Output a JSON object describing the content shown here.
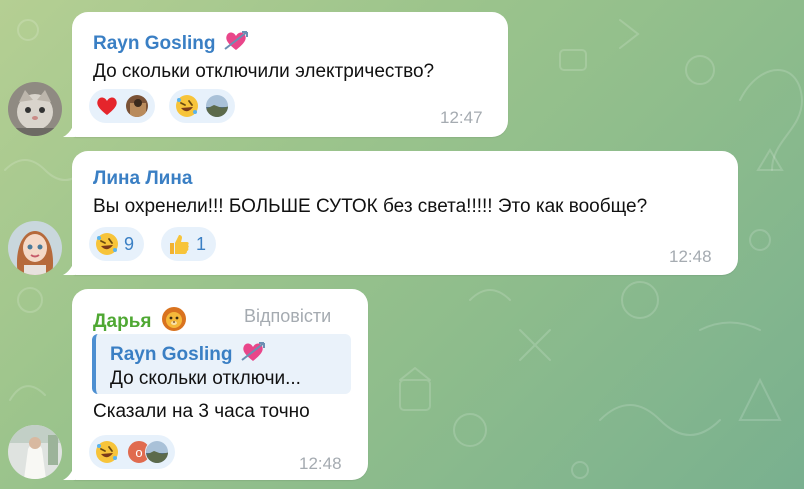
{
  "messages": [
    {
      "author": "Rayn Gosling",
      "author_emoji": "heart-with-arrow-icon",
      "author_color": "#3a7fc4",
      "text": "До скольки отключили электричество?",
      "time": "12:47",
      "reactions": [
        {
          "emoji": "red-heart-icon",
          "count": ""
        },
        {
          "emoji": "rofl-icon",
          "count": ""
        }
      ]
    },
    {
      "author": "Лина Лина",
      "author_color": "#3a7fc4",
      "text": "Вы охренели!!! БОЛЬШЕ СУТОК без света!!!!! Это как вообще?",
      "time": "12:48",
      "reactions": [
        {
          "emoji": "rofl-icon",
          "count": "9"
        },
        {
          "emoji": "thumbs-up-icon",
          "count": "1"
        }
      ]
    },
    {
      "author": "Дарья",
      "author_emoji": "lion-face-icon",
      "author_color": "#4fa833",
      "reply_label": "Відповісти",
      "quote": {
        "author": "Rayn Gosling",
        "text": "До скольки отключи..."
      },
      "text": "Сказали на 3 часа точно",
      "time": "12:48",
      "reactions": [
        {
          "emoji": "rofl-icon",
          "count": "",
          "avatar_letter": "о"
        }
      ]
    }
  ],
  "colors": {
    "accent": "#3a7fc4",
    "bubble": "#ffffff",
    "reaction_bg": "#e7f1fb",
    "time": "#a5abb1"
  }
}
